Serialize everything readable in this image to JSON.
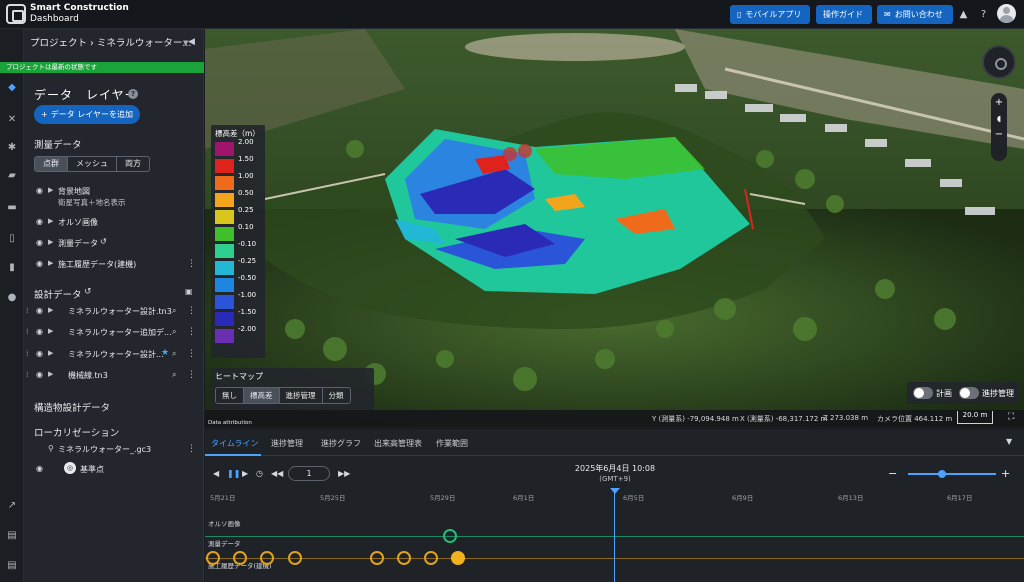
{
  "header": {
    "brand_line1": "Smart Construction",
    "brand_line2": "Dashboard",
    "buttons": [
      "モバイルアプリ",
      "操作ガイド",
      "お問い合わせ"
    ]
  },
  "panel": {
    "breadcrumb": "プロジェクト › ミネラルウォーター...",
    "status": "プロジェクトは最新の状態です",
    "title": "データ　レイヤー",
    "add_button": "データ レイヤーを追加",
    "survey_section": "測量データ",
    "survey_tabs": [
      "点群",
      "メッシュ",
      "両方"
    ],
    "survey_tab_selected": "点群",
    "layers": [
      {
        "label": "背景地図",
        "sub": "衛星写真＋地名表示"
      },
      {
        "label": "オルソ画像"
      },
      {
        "label": "測量データ"
      },
      {
        "label": "施工履歴データ(建機)"
      }
    ],
    "design_section": "設計データ",
    "design_items": [
      "ミネラルウォーター設計.tn3",
      "ミネラルウォーター追加デ...",
      "ミネラルウォーター設計...",
      "機械線.tn3"
    ],
    "structure_section": "構造物設計データ",
    "local_section": "ローカリゼーション",
    "local_file": "ミネラルウォーター_.gc3",
    "base_point": "基準点"
  },
  "view": {
    "legend_title": "標高差（m）",
    "legend": [
      {
        "label": "2.00",
        "color": "#a0146e"
      },
      {
        "label": "1.50",
        "color": "#e0221c"
      },
      {
        "label": "1.00",
        "color": "#ef6a1a"
      },
      {
        "label": "0.50",
        "color": "#f2a51c"
      },
      {
        "label": "0.25",
        "color": "#d8c61d"
      },
      {
        "label": "0.10",
        "color": "#3fc02a"
      },
      {
        "label": "-0.10",
        "color": "#2fcf8e"
      },
      {
        "label": "-0.25",
        "color": "#23b7d6"
      },
      {
        "label": "-0.50",
        "color": "#1e86e0"
      },
      {
        "label": "-1.00",
        "color": "#2b55d9"
      },
      {
        "label": "-1.50",
        "color": "#2b2ab8"
      },
      {
        "label": "-2.00",
        "color": "#6a2fb0"
      }
    ],
    "heatmap_title": "ヒートマップ",
    "heatmap_options": [
      "無し",
      "標高差",
      "進捗管理",
      "分類"
    ],
    "heatmap_selected": "標高差",
    "toggle_plan": "計画",
    "toggle_progress": "進捗管理",
    "coords": {
      "y": "Y (測量系) -79,094.948 m",
      "x": "X (測量系) -68,317.172 m",
      "z": "Z 273.038 m",
      "camera": "カメラ位置 464.112 m"
    },
    "scale": "20.0 m",
    "attribution": "Data attribution"
  },
  "timeline": {
    "tabs": [
      "タイムライン",
      "進捗管理",
      "進捗グラフ",
      "出来高管理表",
      "作業範囲"
    ],
    "tab_selected": "タイムライン",
    "speed": "1",
    "date": "2025年6月4日 10:08",
    "tz": "(GMT+9)",
    "ticks": [
      "5月21日",
      "5月25日",
      "5月29日",
      "6月1日",
      "6月5日",
      "6月9日",
      "6月13日",
      "6月17日"
    ],
    "lanes": [
      "オルソ画像",
      "測量データ",
      "施工履歴データ(建機)"
    ]
  }
}
